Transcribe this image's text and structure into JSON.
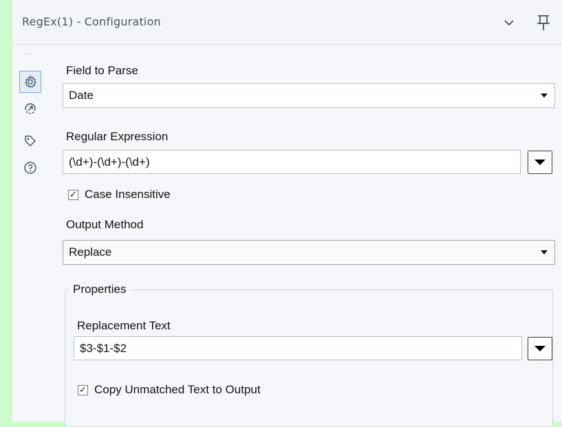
{
  "header": {
    "title": "RegEx(1) - Configuration",
    "collapse_icon": "chevron-down-icon",
    "pin_icon": "pin-icon"
  },
  "rail": {
    "more_icon": "dots-icon",
    "items": [
      {
        "icon": "gear-icon",
        "active": true
      },
      {
        "icon": "connection-icon",
        "active": false
      },
      {
        "icon": "tag-icon",
        "active": false
      },
      {
        "icon": "help-icon",
        "active": false
      }
    ]
  },
  "field_to_parse": {
    "label": "Field to Parse",
    "value": "Date"
  },
  "regex": {
    "label": "Regular Expression",
    "value": "(\\d+)-(\\d+)-(\\d+)"
  },
  "case_insensitive": {
    "label": "Case Insensitive",
    "checked": true
  },
  "output_method": {
    "label": "Output Method",
    "value": "Replace"
  },
  "properties": {
    "legend": "Properties",
    "replacement_label": "Replacement Text",
    "replacement_value": "$3-$1-$2",
    "copy_unmatched_label": "Copy Unmatched Text to Output",
    "copy_unmatched_checked": true
  },
  "colors": {
    "background": "#ccfccc",
    "panel": "#f5f7fa",
    "active_border": "#7fa7d6"
  }
}
